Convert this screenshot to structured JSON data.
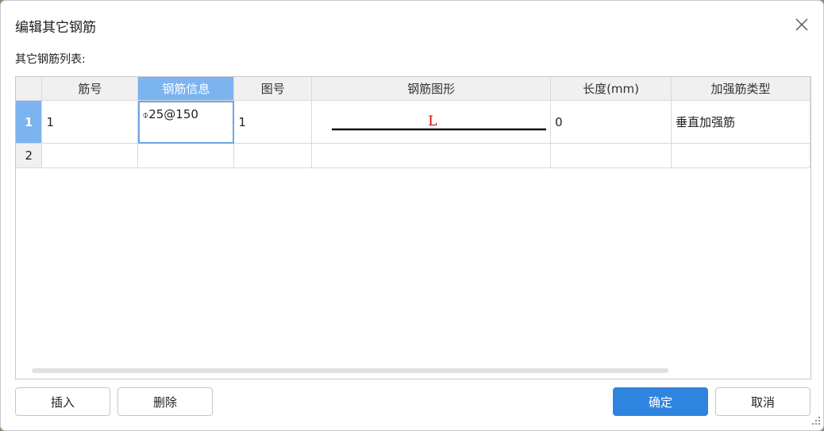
{
  "dialog": {
    "title": "编辑其它钢筋",
    "list_label": "其它钢筋列表:"
  },
  "table": {
    "columns": [
      "筋号",
      "钢筋信息",
      "图号",
      "钢筋图形",
      "长度(mm)",
      "加强筋类型"
    ],
    "active_column": "钢筋信息",
    "rows": [
      {
        "num": "1",
        "jinhao": "1",
        "rebar_symbol": "⌽",
        "rebar_info": "25@150",
        "tuhao": "1",
        "shape_label": "L",
        "length": "0",
        "type": "垂直加强筋"
      },
      {
        "num": "2",
        "jinhao": "",
        "rebar_symbol": "",
        "rebar_info": "",
        "tuhao": "",
        "shape_label": "",
        "length": "",
        "type": ""
      }
    ]
  },
  "buttons": {
    "insert": "插入",
    "delete": "删除",
    "ok": "确定",
    "cancel": "取消"
  },
  "colors": {
    "accent": "#2f84e0",
    "active_header": "#7bb4f0",
    "shape_label": "#d00000"
  },
  "icons": {
    "close": "close-icon",
    "resize": "resize-grip-icon"
  }
}
